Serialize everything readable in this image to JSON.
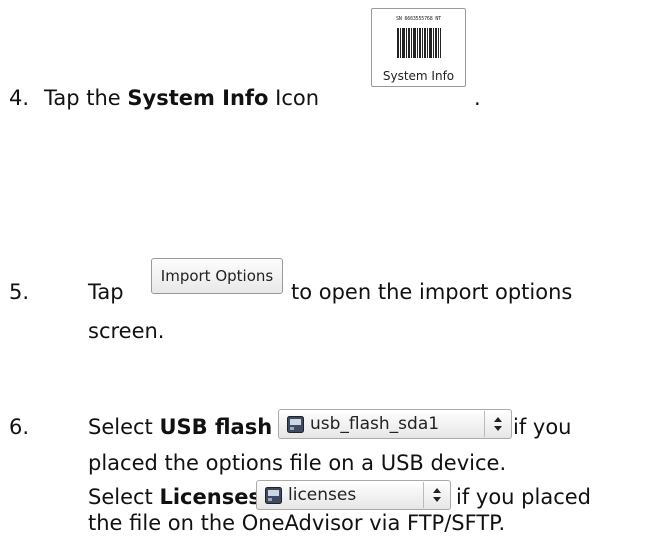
{
  "step4": {
    "number": "4.",
    "prefix": "Tap the ",
    "bold": "System Info",
    "suffix": " Icon",
    "end": ".",
    "icon": {
      "serial": "SN 6663555768 NT",
      "caption": "System Info",
      "icon_name": "barcode-icon"
    }
  },
  "step5": {
    "number": "5.",
    "prefix": "Tap",
    "button_label": "Import Options",
    "suffix": " to open the import options",
    "line2": "screen."
  },
  "step6": {
    "number": "6.",
    "l1_prefix": "Select ",
    "l1_bold": "USB flash",
    "l1_suffix": " if you",
    "l2": "placed the options file on a USB device.",
    "l3_prefix": "Select ",
    "l3_bold": "Licenses",
    "l3_suffix": " if you placed",
    "l4": "the file on the OneAdvisor via FTP/SFTP.",
    "usb_dropdown": "usb_flash_sda1",
    "licenses_dropdown": "licenses"
  }
}
